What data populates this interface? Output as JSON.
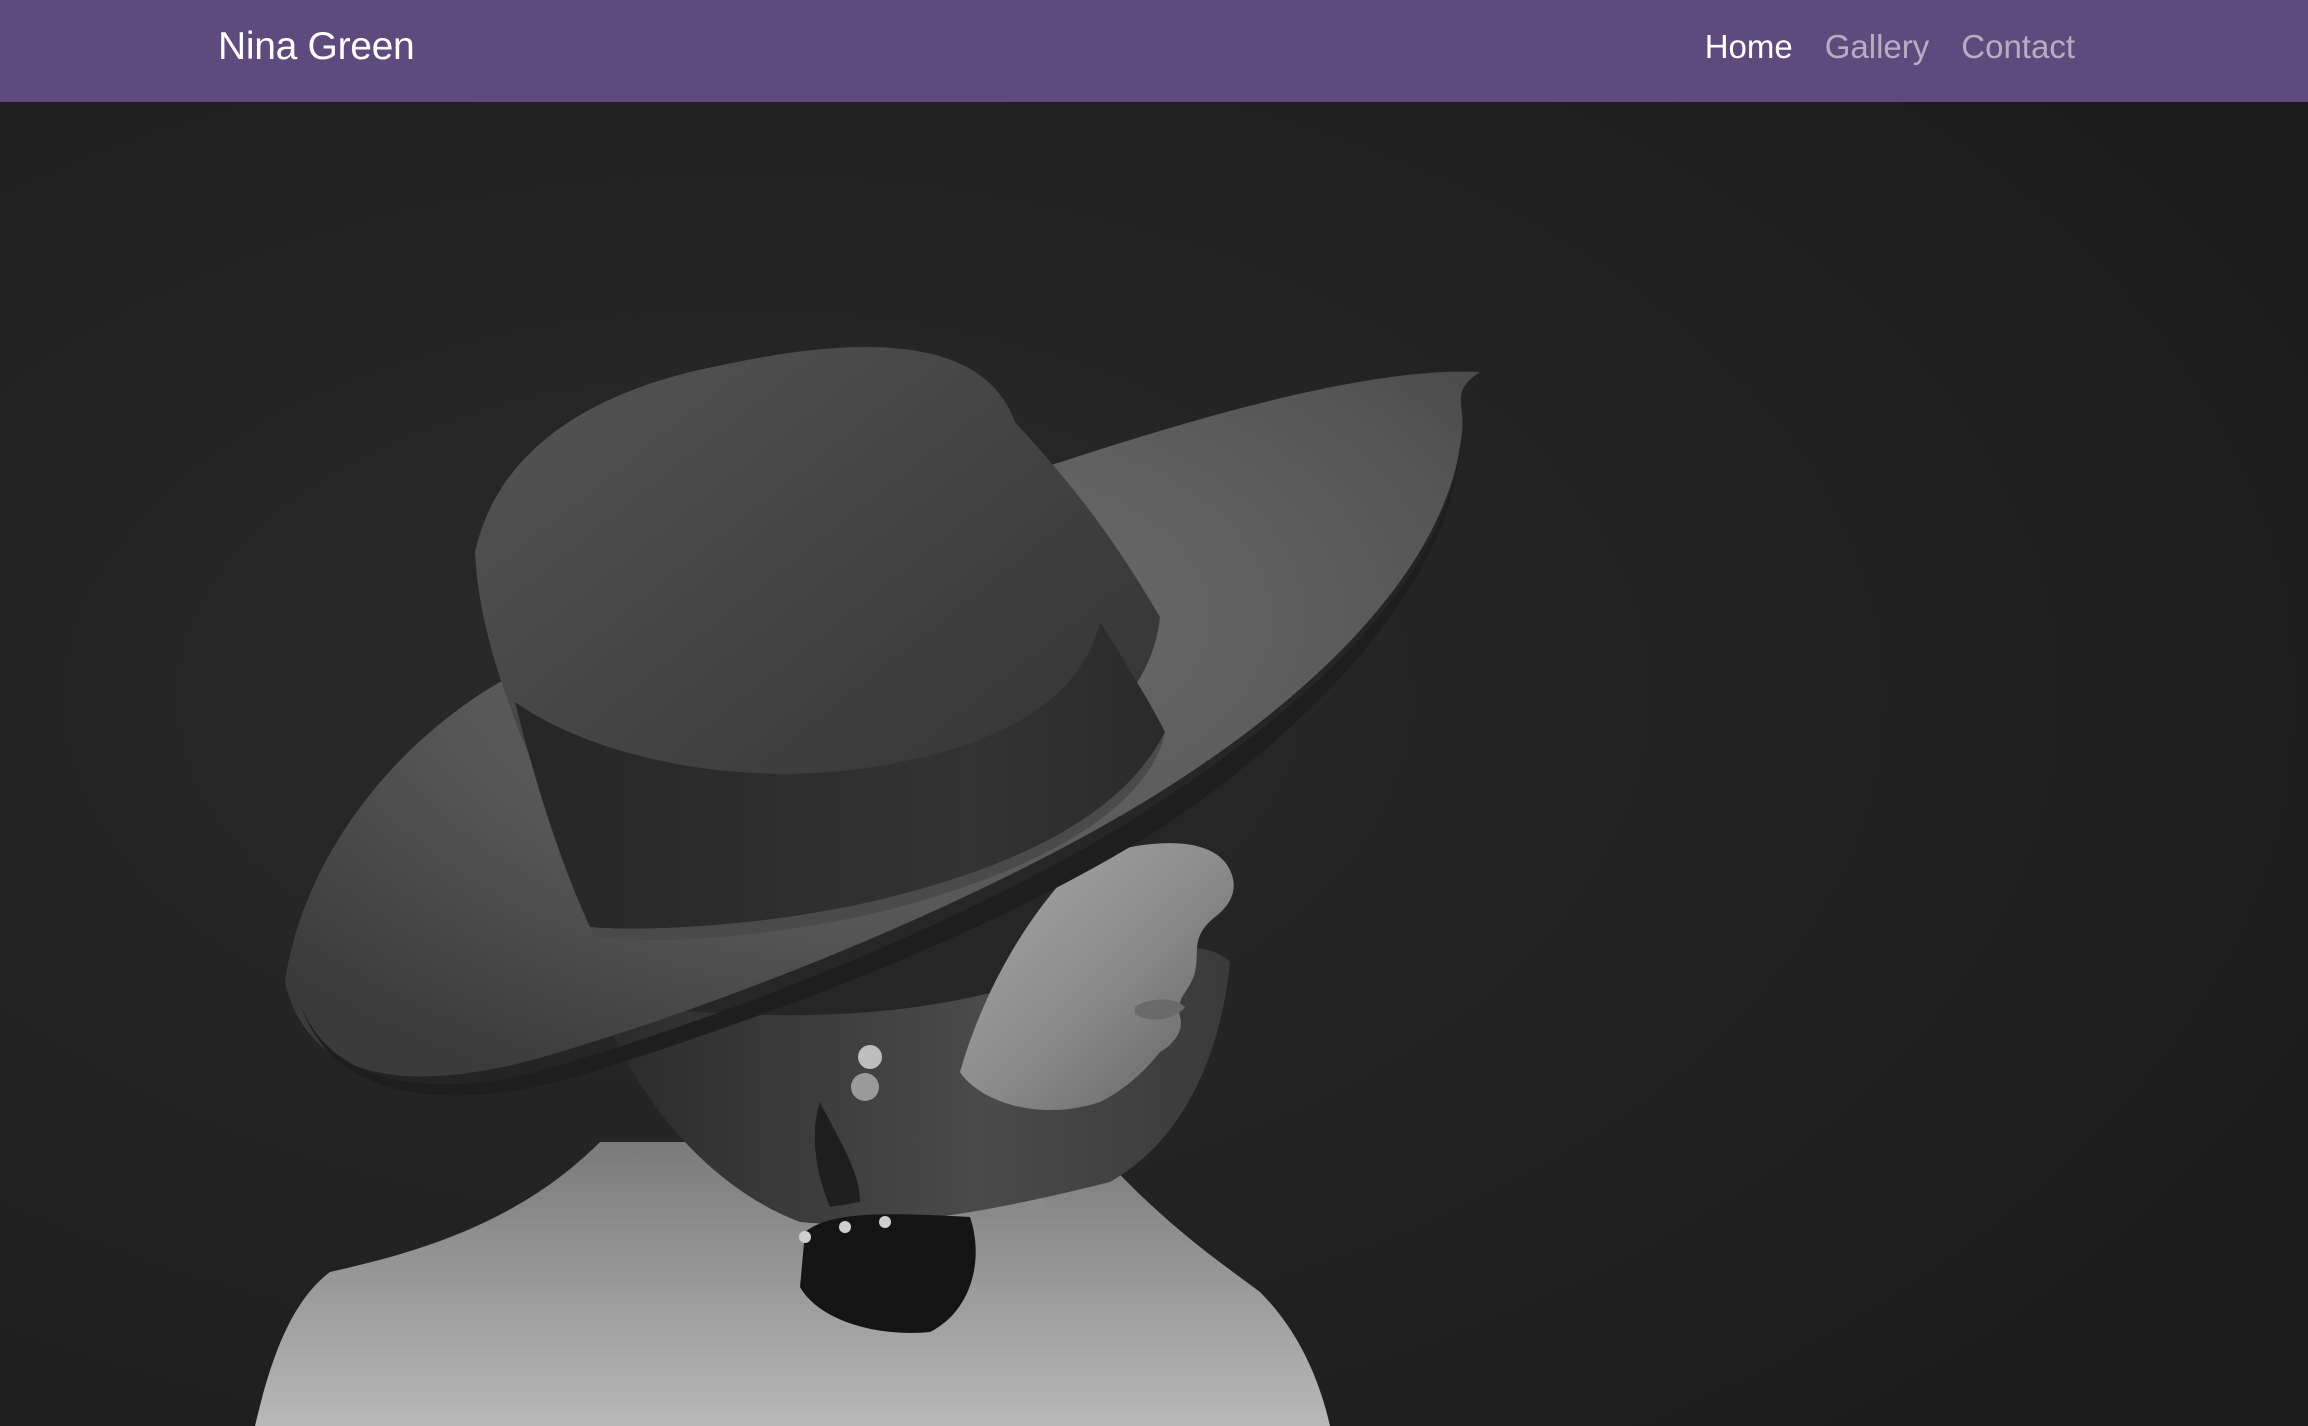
{
  "navbar": {
    "brand": "Nina Green",
    "links": [
      {
        "label": "Home",
        "active": true
      },
      {
        "label": "Gallery",
        "active": false
      },
      {
        "label": "Contact",
        "active": false
      }
    ],
    "background_color": "#5e4a7c"
  },
  "hero": {
    "background_color": "#232323"
  }
}
